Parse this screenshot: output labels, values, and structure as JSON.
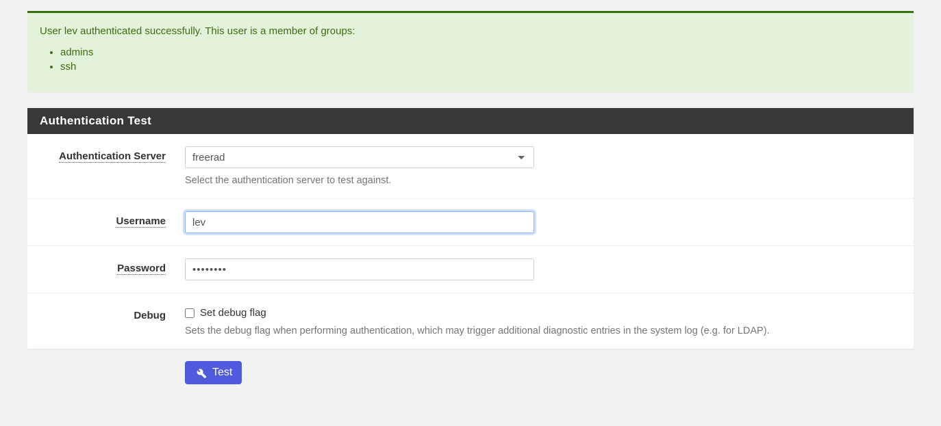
{
  "alert": {
    "message": "User lev authenticated successfully. This user is a member of groups:",
    "groups": [
      "admins",
      "ssh"
    ]
  },
  "panel": {
    "title": "Authentication Test"
  },
  "form": {
    "auth_server_label": "Authentication Server",
    "auth_server_value": "freerad",
    "auth_server_help": "Select the authentication server to test against.",
    "username_label": "Username",
    "username_value": "lev",
    "password_label": "Password",
    "password_value": "••••••••",
    "debug_label": "Debug",
    "debug_checkbox_label": "Set debug flag",
    "debug_help": "Sets the debug flag when performing authentication, which may trigger additional diagnostic entries in the system log (e.g. for LDAP)."
  },
  "buttons": {
    "test": "Test"
  }
}
